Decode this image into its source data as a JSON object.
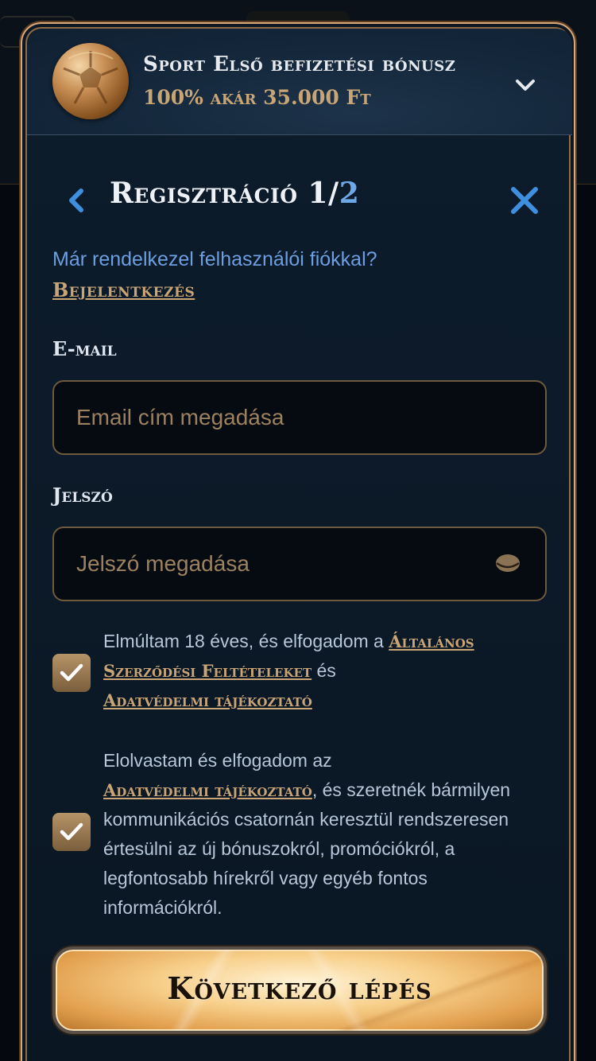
{
  "colors": {
    "gold": "#c9a576",
    "blue_link": "#6c9ee0",
    "accent_blue": "#3f8fe0",
    "modal_border": "#d9a87a",
    "panel_bg": "#0c1a29"
  },
  "bonus": {
    "title": "Sport Első befizetési bónusz",
    "subtitle": "100% akár 35.000 Ft",
    "icon": "football-icon",
    "expand_icon": "chevron-down-icon"
  },
  "registration": {
    "title_main": "Regisztráció 1/",
    "title_step": "2",
    "back_icon": "chevron-left-icon",
    "close_icon": "close-icon"
  },
  "login_prompt": {
    "text": "Már rendelkezel felhasználói fiókkal?",
    "link": "Bejelentkezés"
  },
  "email": {
    "label": "E-mail",
    "placeholder": "Email cím megadása",
    "value": ""
  },
  "password": {
    "label": "Jelszó",
    "placeholder": "Jelszó megadása",
    "value": "",
    "toggle_icon": "eye-icon"
  },
  "consent_terms": {
    "checked": true,
    "text_before": "Elmúltam 18 éves, és elfogadom a ",
    "link_terms": "Általános Szerződési Feltételeket",
    "text_mid": " és ",
    "link_privacy": "Adatvédelmi tájékoztató"
  },
  "consent_marketing": {
    "checked": true,
    "text_before": "Elolvastam és elfogadom az ",
    "link_privacy": "Adatvédelmi tájékoztató",
    "text_after": ", és szeretnék bármilyen kommunikációs csatornán keresztül rendszeresen értesülni az új bónuszokról, promóciókról, a legfontosabb hírekről vagy egyéb fontos információkról."
  },
  "next_button": {
    "label": "Következő lépés"
  }
}
